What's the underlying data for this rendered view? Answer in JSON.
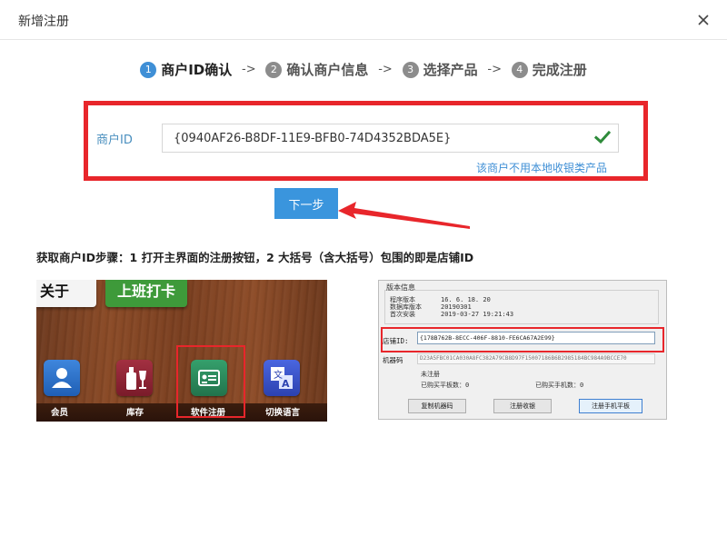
{
  "dialog": {
    "title": "新增注册"
  },
  "steps": [
    {
      "num": "1",
      "label": "商户ID确认",
      "active": true
    },
    {
      "num": "2",
      "label": "确认商户信息",
      "active": false
    },
    {
      "num": "3",
      "label": "选择产品",
      "active": false
    },
    {
      "num": "4",
      "label": "完成注册",
      "active": false
    }
  ],
  "step_separator": "->",
  "form": {
    "merchant_id_label": "商户ID",
    "merchant_id_value": "{0940AF26-B8DF-11E9-BFB0-74D4352BDA5E}",
    "hint": "该商户不用本地收银类产品",
    "next_button": "下一步"
  },
  "instructions": "获取商户ID步骤：1 打开主界面的注册按钮，2 大括号（含大括号）包围的即是店铺ID",
  "left_screenshot": {
    "top_tiles": [
      "关于",
      "上班打卡"
    ],
    "apps": [
      {
        "label": "会员",
        "color": "#2f6fc4",
        "icon": "user-icon"
      },
      {
        "label": "库存",
        "color": "#8e2434",
        "icon": "wine-bottle-icon"
      },
      {
        "label": "软件注册",
        "color": "#2e8a5e",
        "icon": "id-card-icon"
      },
      {
        "label": "切换语言",
        "color": "#3b55c9",
        "icon": "translate-icon"
      }
    ]
  },
  "right_screenshot": {
    "section_title": "版本信息",
    "version_rows": [
      {
        "k": "程序版本",
        "v": "16. 6. 18. 20"
      },
      {
        "k": "数据库版本",
        "v": "20190301"
      },
      {
        "k": "首次安装",
        "v": "2019-03-27 19:21:43"
      }
    ],
    "store_id_label": "店铺ID:",
    "store_id_value": "{178B762B-8ECC-406F-8810-FE6CA67A2E99}",
    "machine_code_label": "机器码",
    "machine_code_value": "D23A5FBC01CA030A8FC382A79CB8D97F15007186B6B2985184BC984A9BCCE70",
    "unregistered": "未注册",
    "bought_tablets": "已购买平板数：0",
    "bought_phones": "已购买手机数：0",
    "buttons": [
      "复制机器码",
      "注册收银",
      "注册手机平板"
    ]
  }
}
